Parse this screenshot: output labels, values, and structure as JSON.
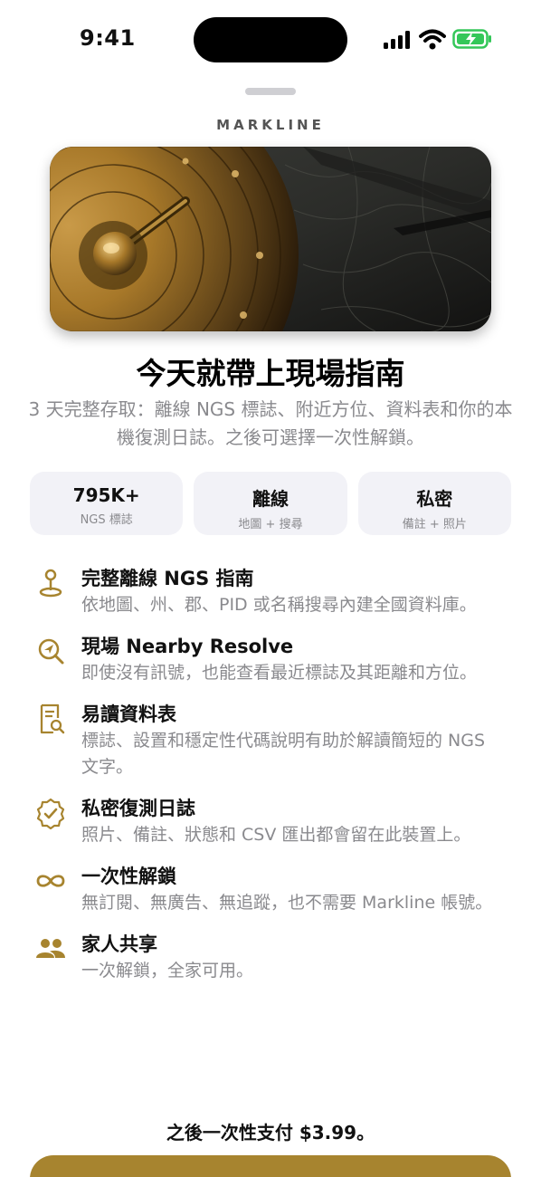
{
  "status_bar": {
    "time": "9:41"
  },
  "brand": "MARKLINE",
  "hero": {
    "description": "brass survey instrument on topographic map"
  },
  "title": "今天就帶上現場指南",
  "subtitle": "3 天完整存取：離線 NGS 標誌、附近方位、資料表和你的本機復測日誌。之後可選擇一次性解鎖。",
  "stats": [
    {
      "value": "795K+",
      "label": "NGS 標誌"
    },
    {
      "value": "離線",
      "label": "地圖 + 搜尋"
    },
    {
      "value": "私密",
      "label": "備註 + 照片"
    }
  ],
  "features": [
    {
      "icon": "map-pin-icon",
      "title": "完整離線 NGS 指南",
      "desc": "依地圖、州、郡、PID 或名稱搜尋內建全國資料庫。"
    },
    {
      "icon": "location-search-icon",
      "title": "現場 Nearby Resolve",
      "desc": "即使沒有訊號，也能查看最近標誌及其距離和方位。"
    },
    {
      "icon": "document-search-icon",
      "title": "易讀資料表",
      "desc": "標誌、設置和穩定性代碼說明有助於解讀簡短的 NGS 文字。"
    },
    {
      "icon": "verified-badge-icon",
      "title": "私密復測日誌",
      "desc": "照片、備註、狀態和 CSV 匯出都會留在此裝置上。"
    },
    {
      "icon": "infinity-icon",
      "title": "一次性解鎖",
      "desc": "無訂閱、無廣告、無追蹤，也不需要 Markline 帳號。"
    },
    {
      "icon": "people-icon",
      "title": "家人共享",
      "desc": "一次解鎖，全家可用。"
    }
  ],
  "price_note": "之後一次性支付 $3.99。",
  "colors": {
    "accent": "#a7842f",
    "muted": "#8a8a8e",
    "card": "#f2f2f7"
  }
}
